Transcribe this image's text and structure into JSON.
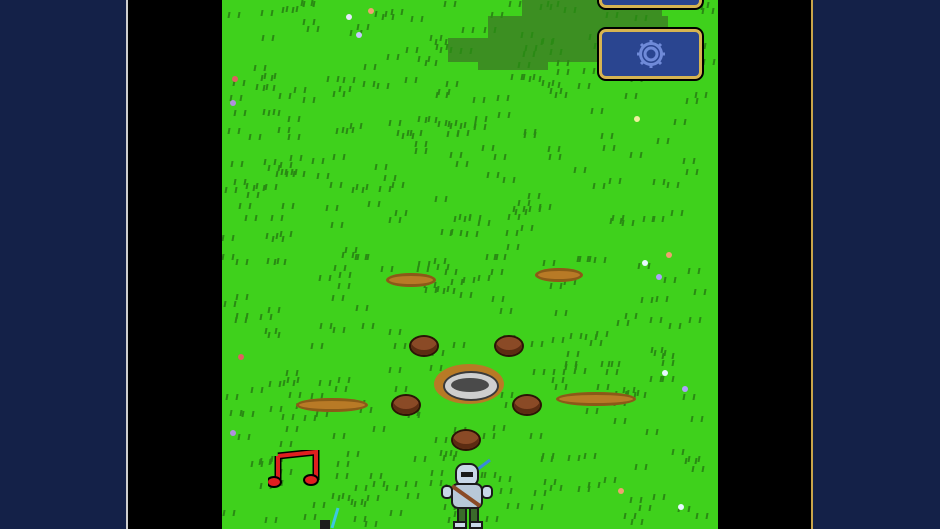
{
  "buttons": {
    "top": {
      "icon": "menu-icon"
    },
    "settings": {
      "icon": "gear-icon"
    }
  },
  "sound": {
    "icon": "music-note-icon",
    "state": "on"
  },
  "colors": {
    "grass": "#3fd11c",
    "grass_shadow": "#3c8f22",
    "button_fill": "#2a4590",
    "button_border": "#d7b451",
    "music_note": "#e01f1f",
    "dirt": "#b87a26",
    "stump": "#8a4a26",
    "page_background": "#142148"
  },
  "scene": {
    "player": "knight-character",
    "objects": [
      "campfire-pit",
      "tree-stumps",
      "dirt-patches",
      "flowers",
      "grass"
    ]
  }
}
